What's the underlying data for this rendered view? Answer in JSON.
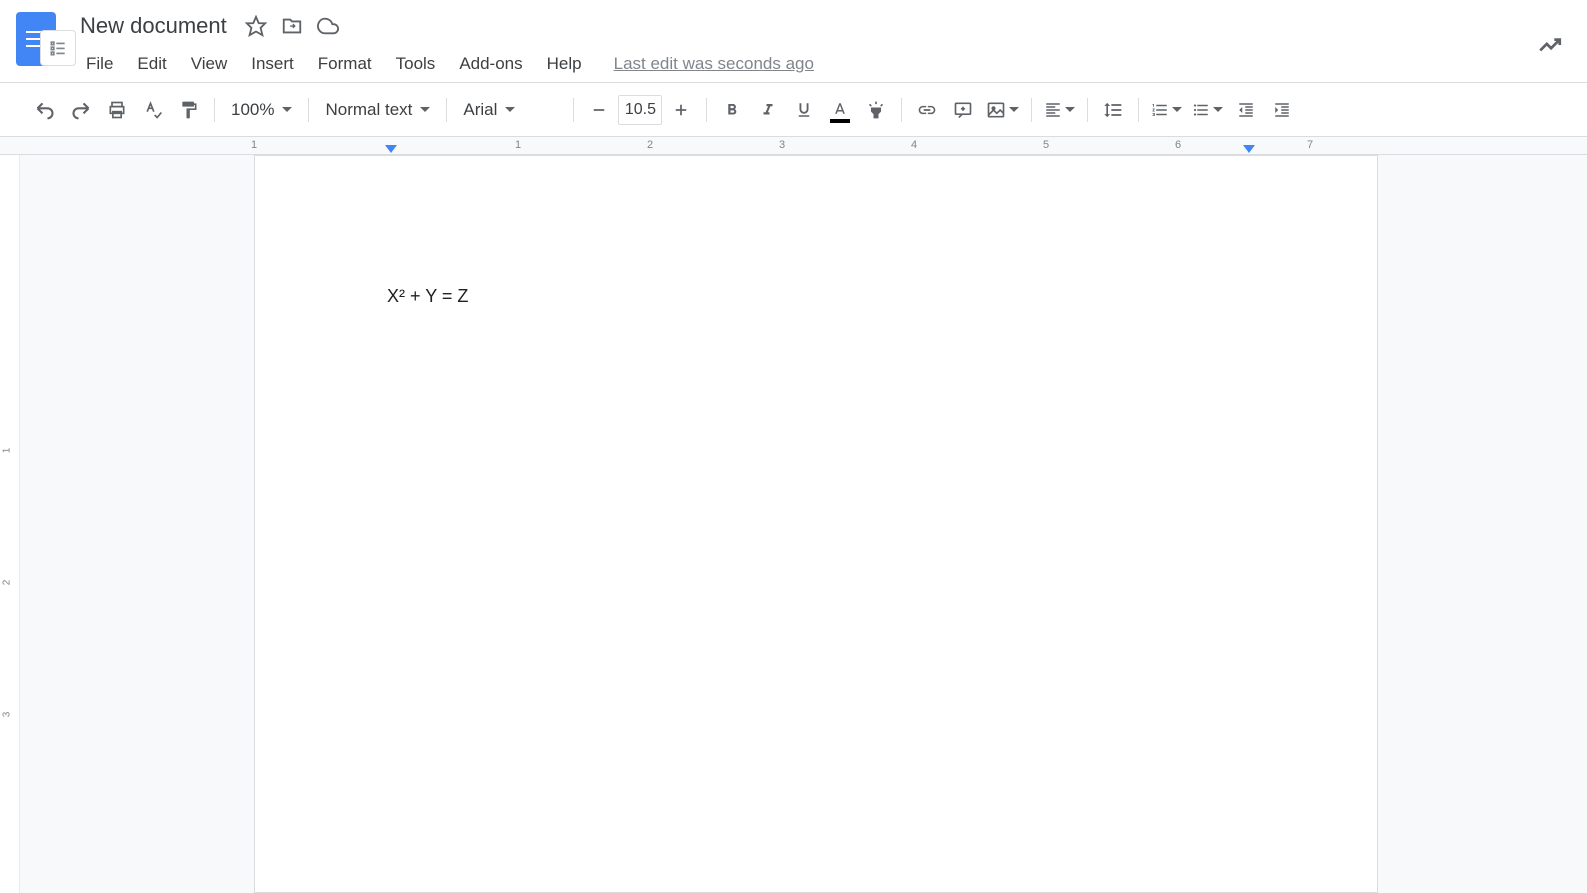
{
  "header": {
    "doc_title": "New document",
    "last_edit": "Last edit was seconds ago"
  },
  "menubar": {
    "items": [
      "File",
      "Edit",
      "View",
      "Insert",
      "Format",
      "Tools",
      "Add-ons",
      "Help"
    ]
  },
  "toolbar": {
    "zoom": "100%",
    "style": "Normal text",
    "font": "Arial",
    "font_size": "10.5"
  },
  "ruler": {
    "horizontal_ticks": [
      "1",
      "1",
      "2",
      "3",
      "4",
      "5",
      "6",
      "7"
    ],
    "vertical_ticks": [
      "1",
      "2",
      "3"
    ]
  },
  "document": {
    "content": "X² + Y = Z"
  }
}
